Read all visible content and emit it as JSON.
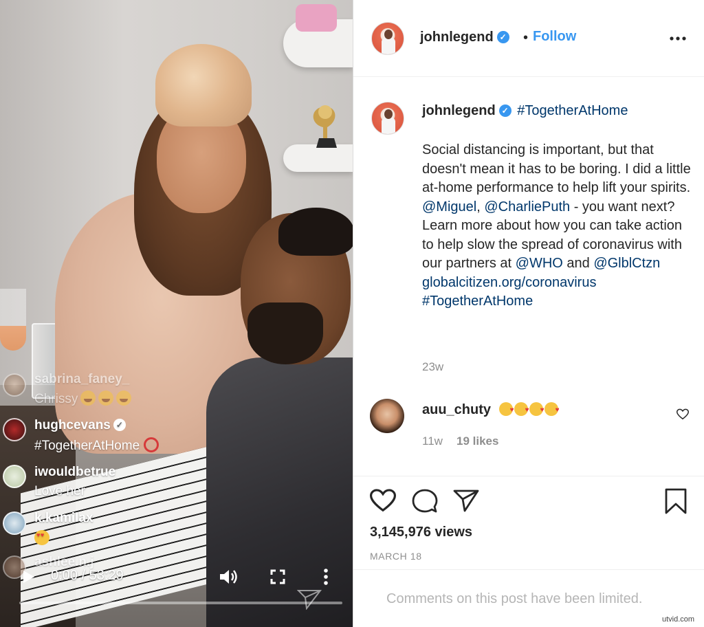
{
  "video": {
    "live_comments": [
      {
        "user": "sabrina_faney_",
        "text": "Chrissy",
        "emoji": "laugh-emoji-x3"
      },
      {
        "user": "hughcevans",
        "verified": true,
        "text": "#TogetherAtHome",
        "emoji": "red-circle"
      },
      {
        "user": "iwouldbetrue",
        "text": "Love her"
      },
      {
        "user": "k.kamilax",
        "text": "",
        "emoji": "heart-eyes-emoji"
      },
      {
        "user": "ashlee.n.j",
        "text": ""
      }
    ],
    "timecode": "0:00 / 53:29",
    "progress_fraction": 0.0,
    "icons": [
      "play-icon",
      "volume-icon",
      "fullscreen-icon",
      "more-vertical-icon",
      "send-icon"
    ]
  },
  "post": {
    "header": {
      "username": "johnlegend",
      "verified": true,
      "dot": "•",
      "follow_label": "Follow",
      "more_icon": "more-horizontal-icon"
    },
    "caption": {
      "username": "johnlegend",
      "hashtag": "#TogetherAtHome",
      "line1": "Social distancing is important, but that doesn't mean it has to be boring. I did a little at-home performance to help lift your spirits.",
      "mention1": "@Miguel",
      "comma": ",",
      "mention2": "@CharliePuth",
      "after_mentions": " - you want next?",
      "line2": "Learn more about how you can take action to help slow the spread of coronavirus with our partners at",
      "mention3": "@WHO",
      "and": " and ",
      "mention4": "@GlblCtzn",
      "link": "globalcitizen.org/coronavirus",
      "hashtag2": "#TogetherAtHome",
      "age": "23w"
    },
    "comment": {
      "user": "auu_chuty",
      "emoji": "kissing-heart-emoji-x4",
      "age": "11w",
      "likes": "19 likes"
    },
    "actions": {
      "icons": [
        "heart-icon",
        "comment-icon",
        "share-icon",
        "bookmark-icon"
      ],
      "views": "3,145,976 views",
      "date": "MARCH 18"
    },
    "limited_text": "Comments on this post have been limited."
  },
  "watermark": "utvid.com",
  "colors": {
    "link_blue": "#3897f0",
    "tag_blue": "#00376b",
    "text": "#262626",
    "secondary": "#8e8e8e",
    "border": "#efefef"
  }
}
